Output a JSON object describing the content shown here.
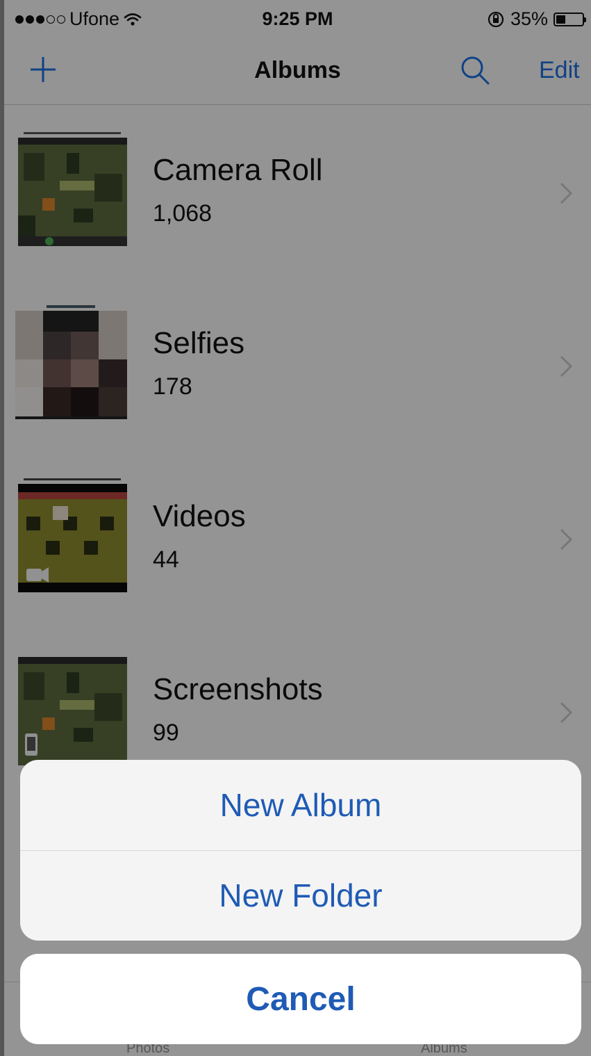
{
  "status_bar": {
    "carrier": "Ufone",
    "time": "9:25 PM",
    "battery_percent": "35%",
    "signal_bars_filled": 3,
    "signal_bars_total": 5,
    "battery_level": 0.35
  },
  "nav": {
    "title": "Albums",
    "edit_label": "Edit",
    "add_icon": "plus-icon",
    "search_icon": "search-icon"
  },
  "albums": [
    {
      "name": "Camera Roll",
      "count": "1,068",
      "thumb": "game-screenshot"
    },
    {
      "name": "Selfies",
      "count": "178",
      "thumb": "pixelated-face"
    },
    {
      "name": "Videos",
      "count": "44",
      "thumb": "game-video"
    },
    {
      "name": "Screenshots",
      "count": "99",
      "thumb": "game-screenshot"
    }
  ],
  "tab_bar": {
    "tabs": [
      {
        "label": "Photos"
      },
      {
        "label": "Albums"
      }
    ]
  },
  "action_sheet": {
    "options": [
      {
        "label": "New Album"
      },
      {
        "label": "New Folder"
      }
    ],
    "cancel_label": "Cancel"
  },
  "colors": {
    "ios_blue": "#1f5bb5",
    "overlay": "rgba(0,0,0,0.4)"
  }
}
